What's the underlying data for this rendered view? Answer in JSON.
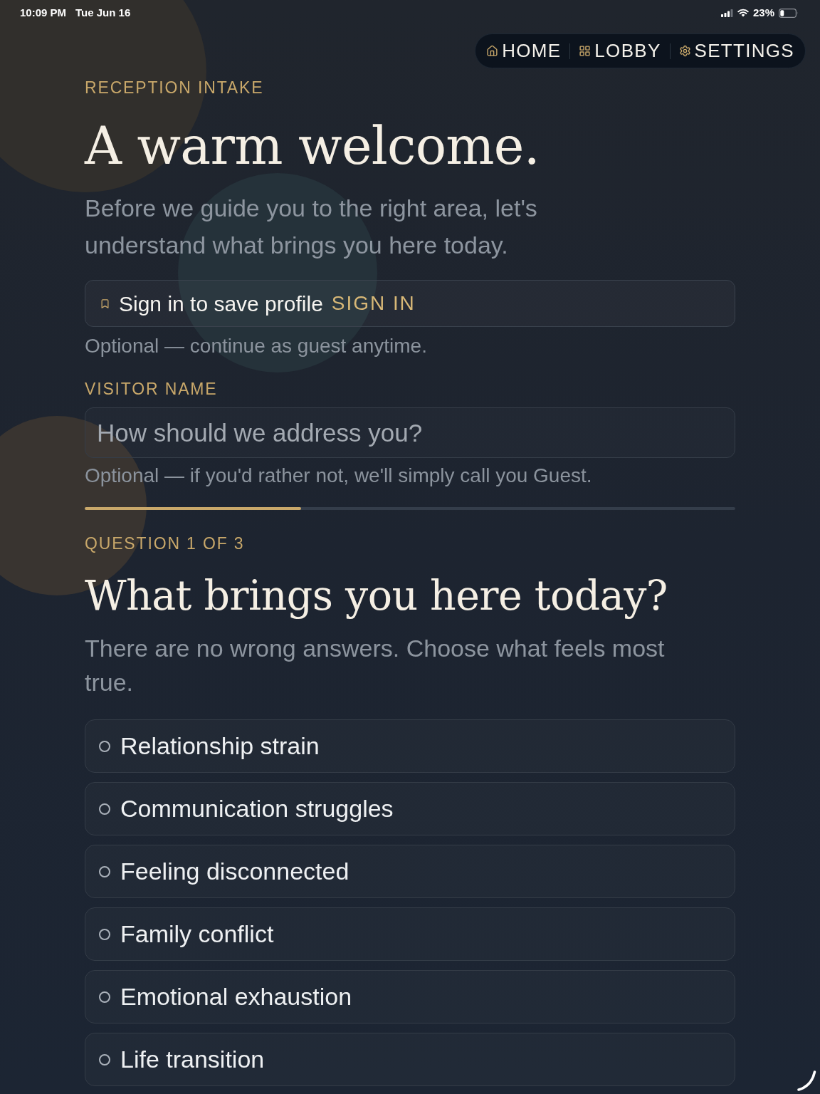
{
  "status_bar": {
    "time": "10:09 PM",
    "date": "Tue Jun 16",
    "battery": "23%"
  },
  "nav": {
    "items": [
      {
        "kind": "home",
        "label": "HOME"
      },
      {
        "kind": "lobby",
        "label": "LOBBY"
      },
      {
        "kind": "settings",
        "label": "SETTINGS"
      }
    ]
  },
  "header": {
    "eyebrow": "RECEPTION INTAKE",
    "title": "A warm welcome.",
    "intro": "Before we guide you to the right area, let's understand what brings you here today."
  },
  "sign_in": {
    "label": "Sign in to save profile",
    "link": "SIGN IN",
    "note": "Optional — continue as guest anytime."
  },
  "visitor_name": {
    "label": "VISITOR NAME",
    "placeholder": "How should we address you?",
    "note": "Optional — if you'd rather not, we'll simply call you Guest."
  },
  "progress": {
    "level": 0.333
  },
  "question": {
    "counter": "QUESTION 1 OF 3",
    "title": "What brings you here today?",
    "hint": "There are no wrong answers. Choose what feels most true.",
    "options": [
      {
        "label": "Relationship strain",
        "selected": false
      },
      {
        "label": "Communication struggles",
        "selected": false
      },
      {
        "label": "Feeling disconnected",
        "selected": false
      },
      {
        "label": "Family conflict",
        "selected": false
      },
      {
        "label": "Emotional exhaustion",
        "selected": false
      },
      {
        "label": "Life transition",
        "selected": false
      }
    ]
  }
}
